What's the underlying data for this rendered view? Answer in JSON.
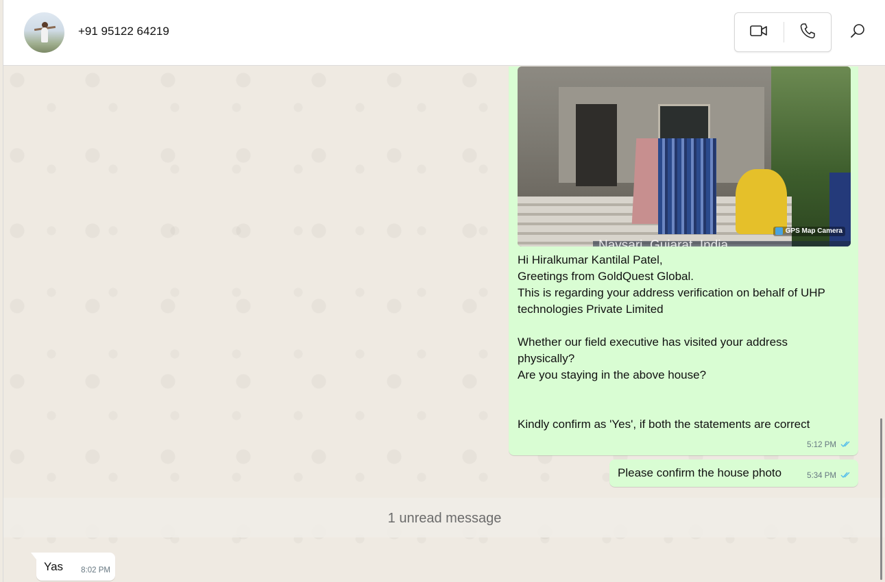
{
  "header": {
    "contact_name": "+91 95122 64219",
    "video_call_icon": "video-camera-icon",
    "voice_call_icon": "phone-icon",
    "search_icon": "search-icon"
  },
  "messages": {
    "photo_message": {
      "image_badge": "GPS Map Camera",
      "image_overlay_text": "Navsari, Gujarat, India",
      "text": "Hi Hiralkumar Kantilal Patel,\nGreetings from GoldQuest Global.\nThis is regarding your address verification on behalf of UHP technologies Private Limited\n\nWhether our field executive has visited your address physically?\nAre you staying in the above house?\n\n\nKindly confirm as 'Yes', if both the statements are correct",
      "time": "5:12 PM",
      "status_icon": "double-check-read-icon"
    },
    "confirm_message": {
      "text": "Please confirm the house photo",
      "time": "5:34 PM",
      "status_icon": "double-check-read-icon"
    },
    "unread_divider": "1 unread message",
    "incoming_message": {
      "text": "Yas",
      "time": "8:02 PM"
    }
  },
  "colors": {
    "outgoing_bubble": "#d9fdd3",
    "incoming_bubble": "#ffffff",
    "read_ticks": "#53bdeb",
    "chat_background": "#efeae2"
  }
}
